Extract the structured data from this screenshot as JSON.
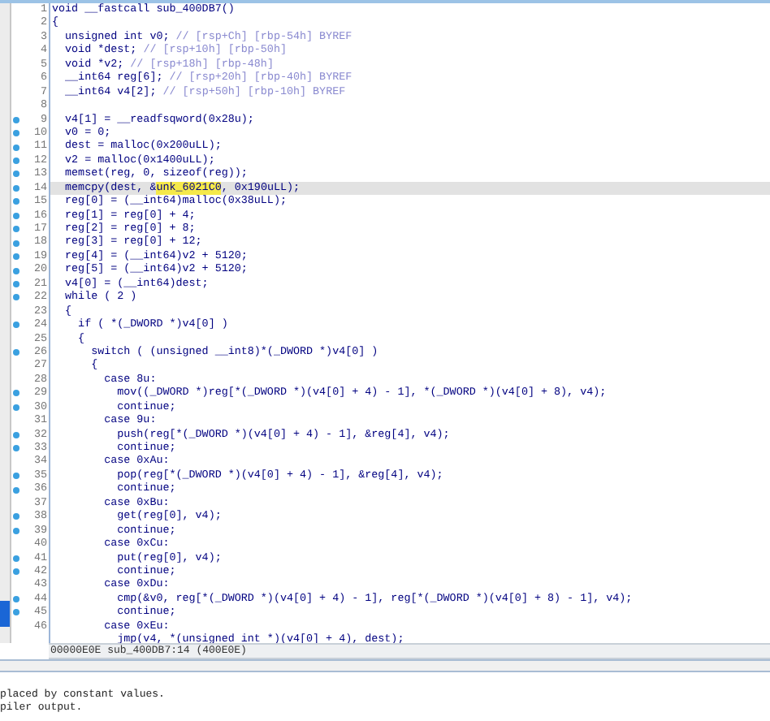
{
  "code_view": {
    "lines": [
      {
        "number": "1",
        "text": "void __fastcall sub_400DB7()",
        "breakpoint": false,
        "selected": false
      },
      {
        "number": "2",
        "text": "{",
        "breakpoint": false,
        "selected": false
      },
      {
        "number": "3",
        "text": "  unsigned int v0; ",
        "comment": "// [rsp+Ch] [rbp-54h] BYREF",
        "breakpoint": false,
        "selected": false
      },
      {
        "number": "4",
        "text": "  void *dest; ",
        "comment": "// [rsp+10h] [rbp-50h]",
        "breakpoint": false,
        "selected": false
      },
      {
        "number": "5",
        "text": "  void *v2; ",
        "comment": "// [rsp+18h] [rbp-48h]",
        "breakpoint": false,
        "selected": false
      },
      {
        "number": "6",
        "text": "  __int64 reg[6]; ",
        "comment": "// [rsp+20h] [rbp-40h] BYREF",
        "breakpoint": false,
        "selected": false
      },
      {
        "number": "7",
        "text": "  __int64 v4[2]; ",
        "comment": "// [rsp+50h] [rbp-10h] BYREF",
        "breakpoint": false,
        "selected": false
      },
      {
        "number": "8",
        "breakpoint": false,
        "selected": false
      },
      {
        "number": "9",
        "text": "  v4[1] = __readfsqword(0x28u);",
        "breakpoint": true,
        "selected": false
      },
      {
        "number": "10",
        "text": "  v0 = 0;",
        "breakpoint": true,
        "selected": false
      },
      {
        "number": "11",
        "text": "  dest = malloc(0x200uLL);",
        "breakpoint": true,
        "selected": false
      },
      {
        "number": "12",
        "text": "  v2 = malloc(0x1400uLL);",
        "breakpoint": true,
        "selected": false
      },
      {
        "number": "13",
        "text": "  memset(reg, 0, sizeof(reg));",
        "breakpoint": true,
        "selected": false
      },
      {
        "number": "14",
        "parts": [
          {
            "text": "  memcpy(dest, &",
            "highlighted": false
          },
          {
            "text": "unk_6021C0",
            "highlighted": true
          },
          {
            "text": ", 0x190uLL);",
            "highlighted": false
          }
        ],
        "breakpoint": true,
        "selected": true
      },
      {
        "number": "15",
        "text": "  reg[0] = (__int64)malloc(0x38uLL);",
        "breakpoint": true,
        "selected": false
      },
      {
        "number": "16",
        "text": "  reg[1] = reg[0] + 4;",
        "breakpoint": true,
        "selected": false
      },
      {
        "number": "17",
        "text": "  reg[2] = reg[0] + 8;",
        "breakpoint": true,
        "selected": false
      },
      {
        "number": "18",
        "text": "  reg[3] = reg[0] + 12;",
        "breakpoint": true,
        "selected": false
      },
      {
        "number": "19",
        "text": "  reg[4] = (__int64)v2 + 5120;",
        "breakpoint": true,
        "selected": false
      },
      {
        "number": "20",
        "text": "  reg[5] = (__int64)v2 + 5120;",
        "breakpoint": true,
        "selected": false
      },
      {
        "number": "21",
        "text": "  v4[0] = (__int64)dest;",
        "breakpoint": true,
        "selected": false
      },
      {
        "number": "22",
        "text": "  while ( 2 )",
        "breakpoint": true,
        "selected": false
      },
      {
        "number": "23",
        "text": "  {",
        "breakpoint": false,
        "selected": false
      },
      {
        "number": "24",
        "text": "    if ( *(_DWORD *)v4[0] )",
        "breakpoint": true,
        "selected": false
      },
      {
        "number": "25",
        "text": "    {",
        "breakpoint": false,
        "selected": false
      },
      {
        "number": "26",
        "text": "      switch ( (unsigned __int8)*(_DWORD *)v4[0] )",
        "breakpoint": true,
        "selected": false
      },
      {
        "number": "27",
        "text": "      {",
        "breakpoint": false,
        "selected": false
      },
      {
        "number": "28",
        "text": "        case 8u:",
        "breakpoint": false,
        "selected": false
      },
      {
        "number": "29",
        "text": "          mov((_DWORD *)reg[*(_DWORD *)(v4[0] + 4) - 1], *(_DWORD *)(v4[0] + 8), v4);",
        "breakpoint": true,
        "selected": false
      },
      {
        "number": "30",
        "text": "          continue;",
        "breakpoint": true,
        "selected": false
      },
      {
        "number": "31",
        "text": "        case 9u:",
        "breakpoint": false,
        "selected": false
      },
      {
        "number": "32",
        "text": "          push(reg[*(_DWORD *)(v4[0] + 4) - 1], &reg[4], v4);",
        "breakpoint": true,
        "selected": false
      },
      {
        "number": "33",
        "text": "          continue;",
        "breakpoint": true,
        "selected": false
      },
      {
        "number": "34",
        "text": "        case 0xAu:",
        "breakpoint": false,
        "selected": false
      },
      {
        "number": "35",
        "text": "          pop(reg[*(_DWORD *)(v4[0] + 4) - 1], &reg[4], v4);",
        "breakpoint": true,
        "selected": false
      },
      {
        "number": "36",
        "text": "          continue;",
        "breakpoint": true,
        "selected": false
      },
      {
        "number": "37",
        "text": "        case 0xBu:",
        "breakpoint": false,
        "selected": false
      },
      {
        "number": "38",
        "text": "          get(reg[0], v4);",
        "breakpoint": true,
        "selected": false
      },
      {
        "number": "39",
        "text": "          continue;",
        "breakpoint": true,
        "selected": false
      },
      {
        "number": "40",
        "text": "        case 0xCu:",
        "breakpoint": false,
        "selected": false
      },
      {
        "number": "41",
        "text": "          put(reg[0], v4);",
        "breakpoint": true,
        "selected": false
      },
      {
        "number": "42",
        "text": "          continue;",
        "breakpoint": true,
        "selected": false
      },
      {
        "number": "43",
        "text": "        case 0xDu:",
        "breakpoint": false,
        "selected": false
      },
      {
        "number": "44",
        "text": "          cmp(&v0, reg[*(_DWORD *)(v4[0] + 4) - 1], reg[*(_DWORD *)(v4[0] + 8) - 1], v4);",
        "breakpoint": true,
        "selected": false
      },
      {
        "number": "45",
        "text": "          continue;",
        "breakpoint": true,
        "selected": false
      },
      {
        "number": "46",
        "text": "        case 0xEu:",
        "breakpoint": false,
        "selected": false
      },
      {
        "text": "          jmp(v4, *(unsigned int *)(v4[0] + 4), dest);",
        "breakpoint": false,
        "selected": false
      }
    ]
  },
  "status_bar": "00000E0E sub_400DB7:14 (400E0E)",
  "output": {
    "lines": [
      "placed by constant values.",
      "piler output."
    ]
  }
}
